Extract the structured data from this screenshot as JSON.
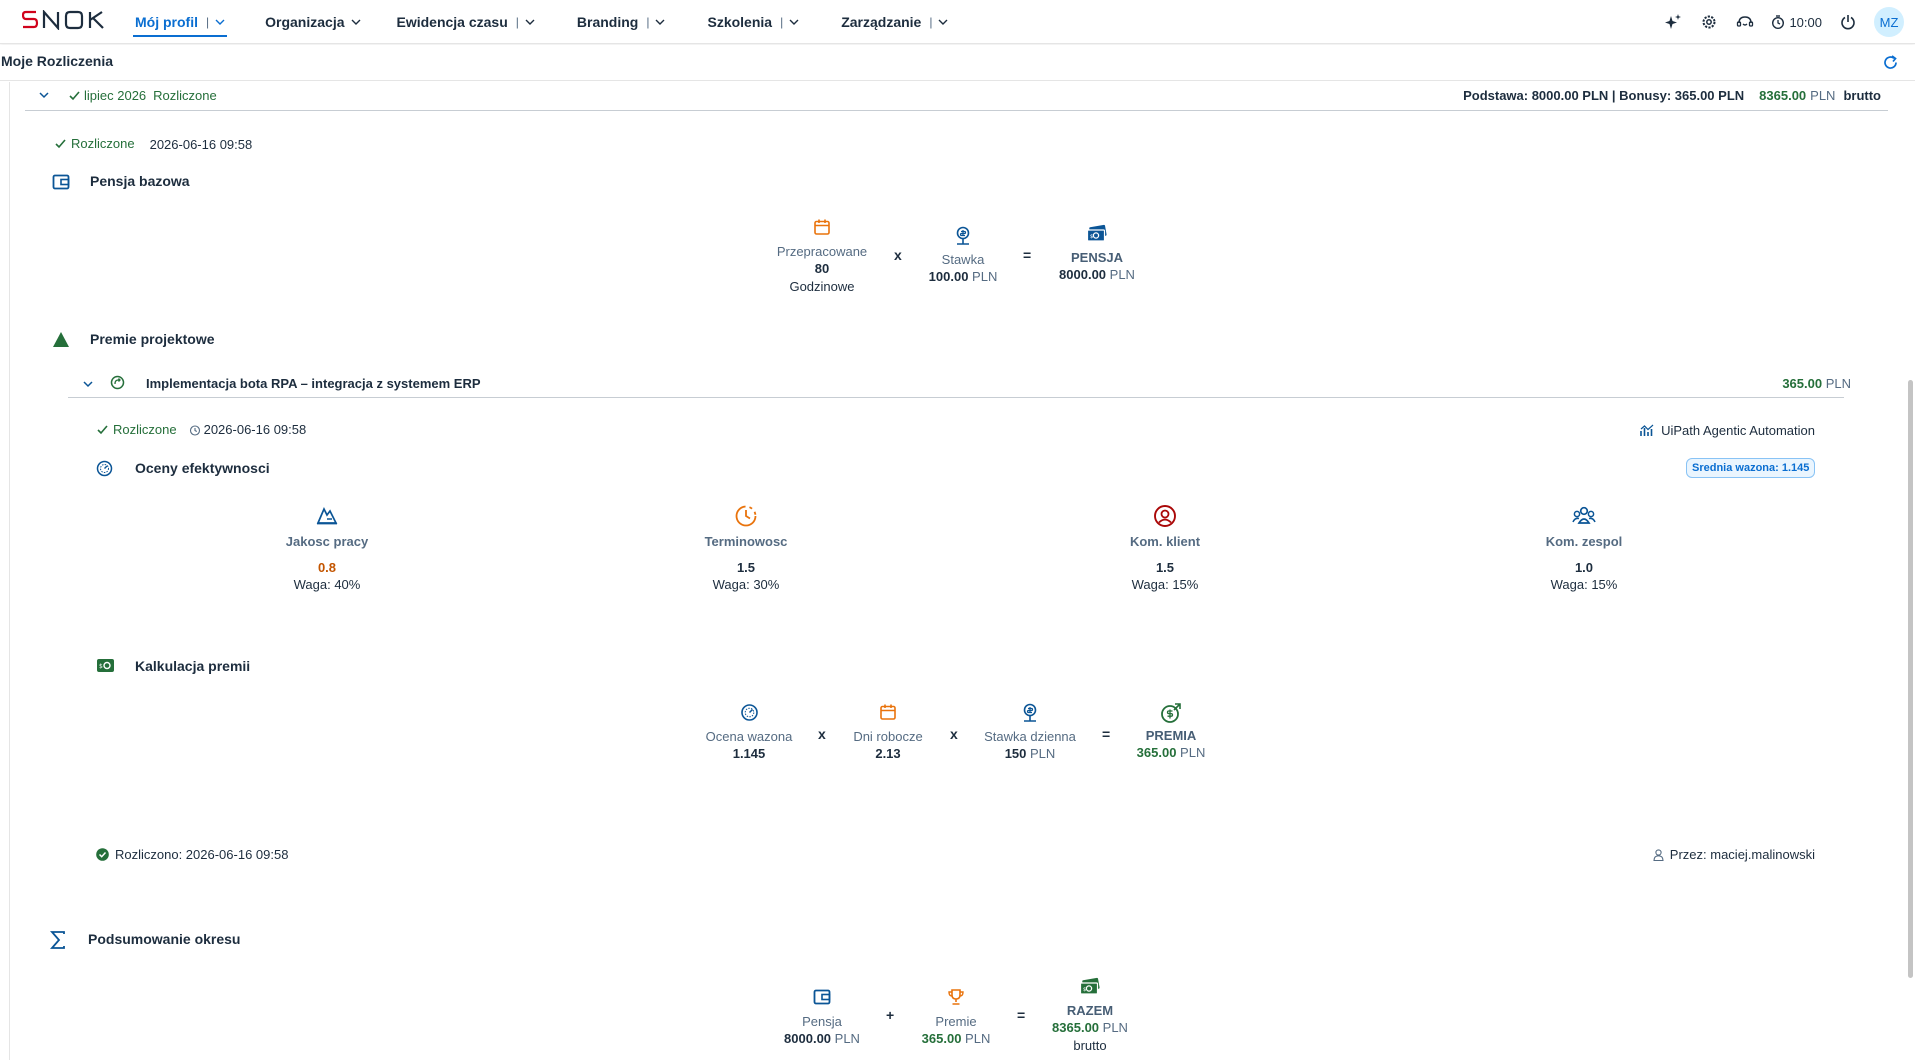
{
  "app": {
    "logo_text": "SNOK",
    "nav": [
      {
        "label": "Mój profil",
        "active": true
      },
      {
        "label": "Organizacja",
        "active": false
      },
      {
        "label": "Ewidencja czasu",
        "active": false
      },
      {
        "label": "Branding",
        "active": false
      },
      {
        "label": "Szkolenia",
        "active": false
      },
      {
        "label": "Zarządzanie",
        "active": false
      }
    ],
    "nav_separator": "|",
    "clock": "10:00",
    "avatar_initials": "MZ",
    "icons": [
      "sparkle-icon",
      "settings-icon",
      "support-icon",
      "timer-icon",
      "power-icon",
      "refresh-icon"
    ]
  },
  "page": {
    "title": "Moje Rozliczenia"
  },
  "period": {
    "label": "lipiec 2026",
    "status": "Rozliczone",
    "summary_text": "Podstawa: 8000.00 PLN | Bonusy: 365.00 PLN",
    "total": "8365.00",
    "currency": "PLN",
    "gross": "brutto",
    "settled_status": "Rozliczone",
    "settled_at": "2026-06-16 09:58"
  },
  "base_salary": {
    "title": "Pensja bazowa",
    "hours_label": "Przepracowane",
    "hours_value": "80",
    "hours_unit": "Godzinowe",
    "op_mult": "x",
    "rate_label": "Stawka",
    "rate_value": "100.00",
    "rate_currency": "PLN",
    "op_eq": "=",
    "result_label": "PENSJA",
    "result_value": "8000.00",
    "result_currency": "PLN"
  },
  "project_bonus": {
    "title": "Premie projektowe",
    "project_name": "Implementacja bota RPA – integracja z systemem ERP",
    "project_amount": "365.00",
    "project_currency": "PLN",
    "status": "Rozliczone",
    "settled_at": "2026-06-16 09:58",
    "client": "UiPath Agentic Automation",
    "ratings_title": "Oceny efektywnosci",
    "weighted_badge": "Srednia wazona: 1.145",
    "metrics": [
      {
        "label": "Jakosc pracy",
        "value": "0.8",
        "weight": "Waga: 40%",
        "color": "#c35500"
      },
      {
        "label": "Terminowosc",
        "value": "1.5",
        "weight": "Waga: 30%",
        "color": "#1d2d3e"
      },
      {
        "label": "Kom. klient",
        "value": "1.5",
        "weight": "Waga: 15%",
        "color": "#1d2d3e"
      },
      {
        "label": "Kom. zespol",
        "value": "1.0",
        "weight": "Waga: 15%",
        "color": "#1d2d3e"
      }
    ],
    "calc_title": "Kalkulacja premii",
    "calc": {
      "score_label": "Ocena wazona",
      "score_value": "1.145",
      "days_label": "Dni robocze",
      "days_value": "2.13",
      "rate_label": "Stawka dzienna",
      "rate_value": "150",
      "rate_currency": "PLN",
      "result_label": "PREMIA",
      "result_value": "365.00",
      "result_currency": "PLN",
      "op_mult": "x",
      "op_eq": "="
    },
    "footer_settled": "Rozliczono: 2026-06-16 09:58",
    "footer_by": "Przez: maciej.malinowski"
  },
  "summary": {
    "title": "Podsumowanie okresu",
    "salary_label": "Pensja",
    "salary_value": "8000.00",
    "salary_currency": "PLN",
    "op_plus": "+",
    "bonus_label": "Premie",
    "bonus_value": "365.00",
    "bonus_currency": "PLN",
    "op_eq": "=",
    "total_label": "RAZEM",
    "total_value": "8365.00",
    "total_currency": "PLN",
    "total_note": "brutto"
  },
  "colors": {
    "brand_blue": "#0a6ed1",
    "icon_blue": "#0b5596",
    "green": "#256f3a",
    "orange": "#e9730c",
    "red": "#aa0808"
  }
}
